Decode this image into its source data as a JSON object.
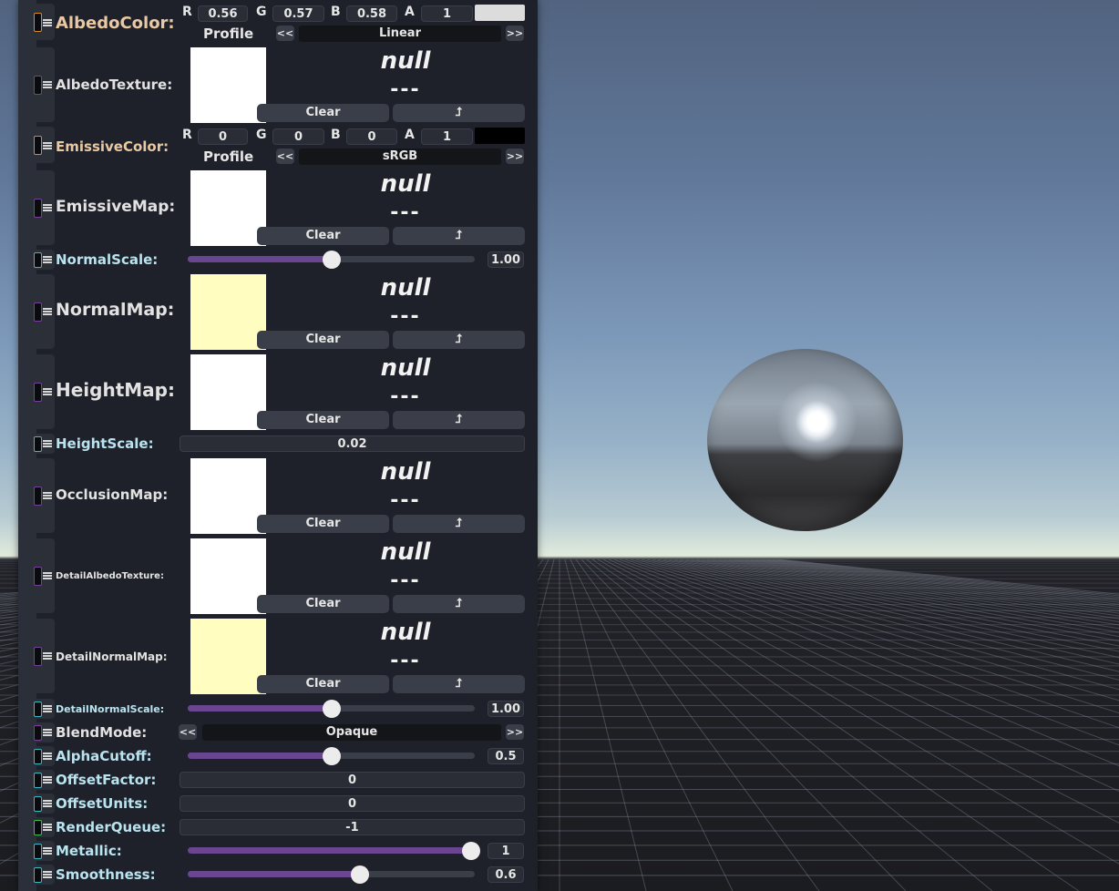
{
  "colors": {
    "orange_socket": "#d98a2a",
    "purple_socket": "#7a3e9e",
    "cyan_socket": "#3fb8c4",
    "green_socket": "#3fbf4a",
    "slider_fill": "#6a4590"
  },
  "albedo_color": {
    "label": "AlbedoColor:",
    "r_label": "R",
    "r": "0.56",
    "g_label": "G",
    "g": "0.57",
    "b_label": "B",
    "b": "0.58",
    "a_label": "A",
    "a": "1",
    "swatch": "#dcdcdc",
    "profile_label": "Profile",
    "profile_value": "Linear",
    "prev": "<<",
    "next": ">>"
  },
  "albedo_texture": {
    "label": "AlbedoTexture:",
    "value": "null",
    "dash": "---",
    "clear": "Clear",
    "pick": "⮥",
    "preview": "#ffffff"
  },
  "emissive_color": {
    "label": "EmissiveColor:",
    "r_label": "R",
    "r": "0",
    "g_label": "G",
    "g": "0",
    "b_label": "B",
    "b": "0",
    "a_label": "A",
    "a": "1",
    "swatch": "#000000",
    "profile_label": "Profile",
    "profile_value": "sRGB",
    "prev": "<<",
    "next": ">>"
  },
  "emissive_map": {
    "label": "EmissiveMap:",
    "value": "null",
    "dash": "---",
    "clear": "Clear",
    "pick": "⮥"
  },
  "normal_scale": {
    "label": "NormalScale:",
    "value": "1.00",
    "fraction": 0.5
  },
  "normal_map": {
    "label": "NormalMap:",
    "value": "null",
    "dash": "---",
    "clear": "Clear",
    "pick": "⮥"
  },
  "height_map": {
    "label": "HeightMap:",
    "value": "null",
    "dash": "---",
    "clear": "Clear",
    "pick": "⮥"
  },
  "height_scale": {
    "label": "HeightScale:",
    "value": "0.02"
  },
  "occlusion_map": {
    "label": "OcclusionMap:",
    "value": "null",
    "dash": "---",
    "clear": "Clear",
    "pick": "⮥"
  },
  "detail_albedo_texture": {
    "label": "DetailAlbedoTexture:",
    "value": "null",
    "dash": "---",
    "clear": "Clear",
    "pick": "⮥"
  },
  "detail_normal_map": {
    "label": "DetailNormalMap:",
    "value": "null",
    "dash": "---",
    "clear": "Clear",
    "pick": "⮥"
  },
  "detail_normal_scale": {
    "label": "DetailNormalScale:",
    "value": "1.00",
    "fraction": 0.5
  },
  "blend_mode": {
    "label": "BlendMode:",
    "value": "Opaque",
    "prev": "<<",
    "next": ">>"
  },
  "alpha_cutoff": {
    "label": "AlphaCutoff:",
    "value": "0.5",
    "fraction": 0.5
  },
  "offset_factor": {
    "label": "OffsetFactor:",
    "value": "0"
  },
  "offset_units": {
    "label": "OffsetUnits:",
    "value": "0"
  },
  "render_queue": {
    "label": "RenderQueue:",
    "value": "-1"
  },
  "metallic": {
    "label": "Metallic:",
    "value": "1",
    "fraction": 1.0
  },
  "smoothness": {
    "label": "Smoothness:",
    "value": "0.6",
    "fraction": 0.6
  }
}
